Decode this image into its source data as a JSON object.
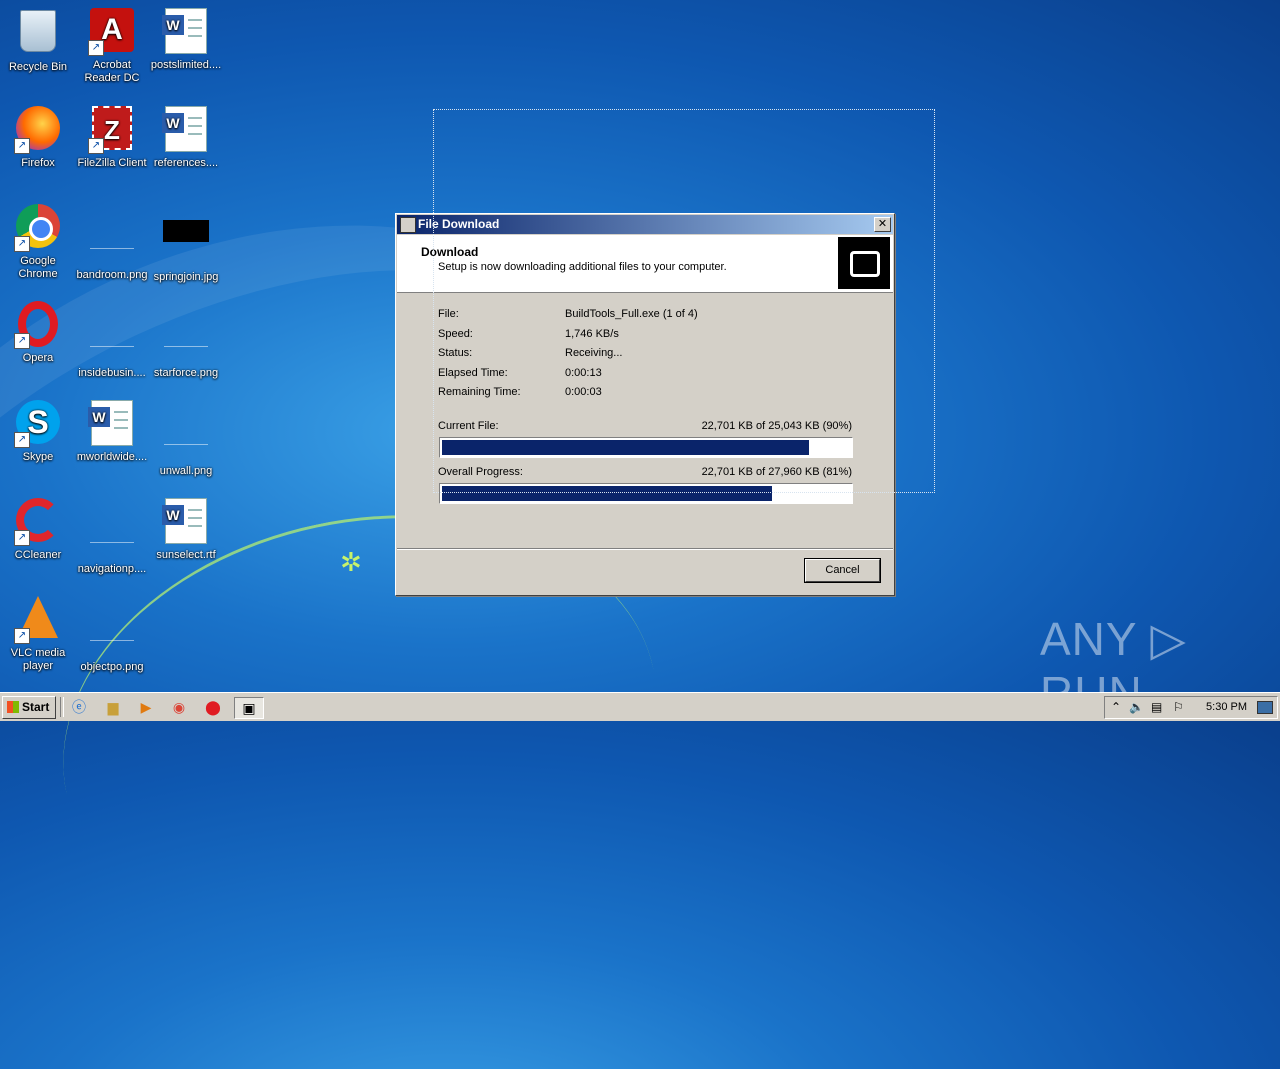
{
  "desktop": {
    "icons": [
      {
        "label": "Recycle Bin",
        "icon": "recycle-bin-icon"
      },
      {
        "label": "Acrobat Reader DC",
        "icon": "acrobat-icon"
      },
      {
        "label": "postslimited....",
        "icon": "word-doc-icon"
      },
      {
        "label": "Firefox",
        "icon": "firefox-icon"
      },
      {
        "label": "FileZilla Client",
        "icon": "filezilla-icon"
      },
      {
        "label": "references....",
        "icon": "word-doc-icon"
      },
      {
        "label": "Google Chrome",
        "icon": "chrome-icon"
      },
      {
        "label": "bandroom.png",
        "icon": "image-file-icon"
      },
      {
        "label": "springjoin.jpg",
        "icon": "image-file-icon"
      },
      {
        "label": "Opera",
        "icon": "opera-icon"
      },
      {
        "label": "insidebusin....",
        "icon": "image-file-icon"
      },
      {
        "label": "starforce.png",
        "icon": "image-file-icon"
      },
      {
        "label": "Skype",
        "icon": "skype-icon"
      },
      {
        "label": "mworldwide....",
        "icon": "word-doc-icon"
      },
      {
        "label": "unwall.png",
        "icon": "image-file-icon"
      },
      {
        "label": "CCleaner",
        "icon": "ccleaner-icon"
      },
      {
        "label": "navigationp....",
        "icon": "image-file-icon"
      },
      {
        "label": "sunselect.rtf",
        "icon": "word-doc-icon"
      },
      {
        "label": "VLC media player",
        "icon": "vlc-icon"
      },
      {
        "label": "objectpo.png",
        "icon": "image-file-icon"
      }
    ]
  },
  "dialog": {
    "title": "File Download",
    "header_title": "Download",
    "header_subtitle": "Setup is now downloading additional files to your computer.",
    "fields": [
      {
        "label": "File:",
        "value": "BuildTools_Full.exe (1 of 4)"
      },
      {
        "label": "Speed:",
        "value": "1,746 KB/s"
      },
      {
        "label": "Status:",
        "value": "Receiving..."
      },
      {
        "label": "Elapsed Time:",
        "value": "0:00:13"
      },
      {
        "label": "Remaining Time:",
        "value": "0:00:03"
      }
    ],
    "current_file_label": "Current File:",
    "current_file_progress_text": "22,701 KB of 25,043 KB (90%)",
    "current_file_percent": 90,
    "overall_label": "Overall Progress:",
    "overall_progress_text": "22,701 KB of 27,960 KB (81%)",
    "overall_percent": 81,
    "cancel_label": "Cancel",
    "close_glyph": "✕"
  },
  "taskbar": {
    "start_label": "Start",
    "clock": "5:30 PM"
  },
  "watermark": "ANY ▷ RUN",
  "colors": {
    "titlebar_start": "#0a246a",
    "titlebar_end": "#a6caf0",
    "progress_fill": "#0a246a",
    "desktop_blue": "#1a73c9"
  }
}
